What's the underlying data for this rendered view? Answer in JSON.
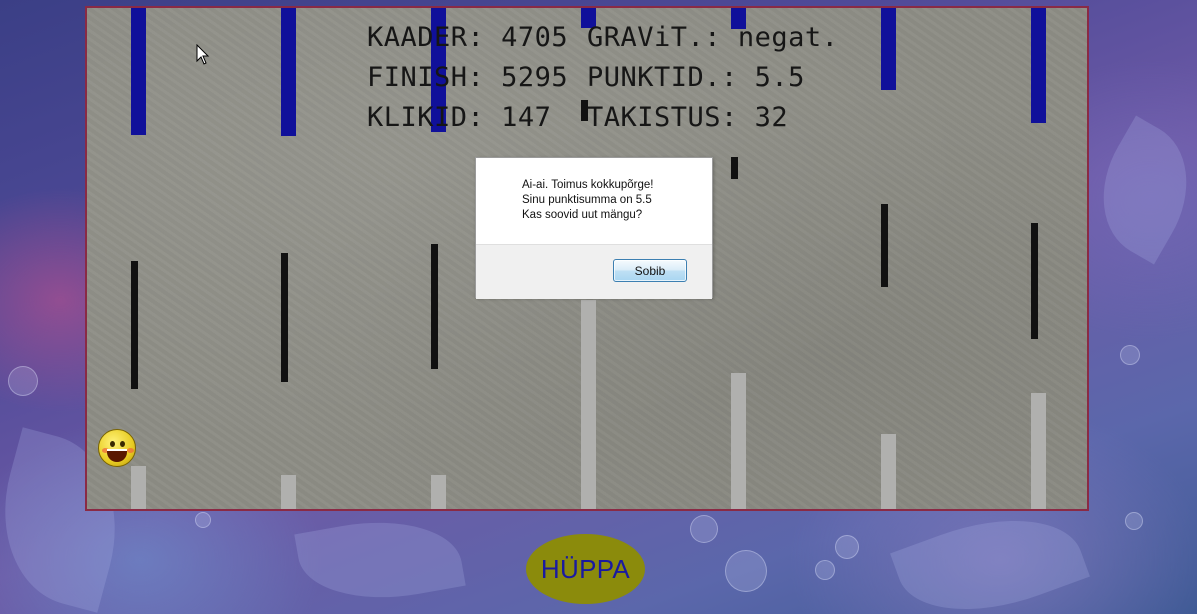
{
  "hud": {
    "frame_label": "KAADER:",
    "frame_value": "4705",
    "gravity_label": "GRAViT.:",
    "gravity_value": "negat.",
    "finish_label": "FINISH:",
    "finish_value": "5295",
    "points_label": "PUNKTID.:",
    "points_value": "5.5",
    "clicks_label": "KLIKID:",
    "clicks_value": "147",
    "obstacles_label": "TAKISTUS:",
    "obstacles_value": "32"
  },
  "dialog": {
    "line1": "Ai-ai. Toimus kokkupõrge!",
    "line2": "Sinu punktisumma on 5.5",
    "line3": "Kas soovid uut mängu?",
    "ok_label": "Sobib"
  },
  "controls": {
    "jump_label": "HÜPPA"
  },
  "colors": {
    "top_bar": "#10109a",
    "mid_bar": "#111111",
    "bottom_bar": "#b0b0ae",
    "board_border": "#8a2a45",
    "jump_button": "#8b8b0c",
    "jump_text": "#1a1aa0"
  },
  "icons": {
    "player": "smiley-face-icon",
    "cursor": "mouse-pointer-icon"
  }
}
